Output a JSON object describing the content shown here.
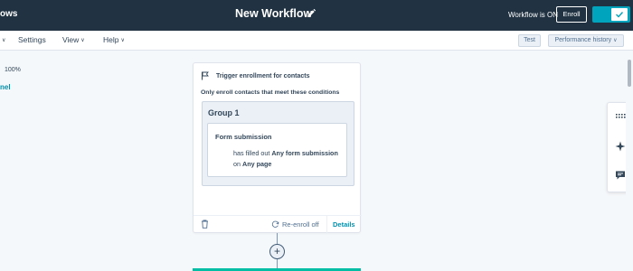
{
  "topbar": {
    "app_name": "ows",
    "title": "New Workflow",
    "workflow_status": "Workflow is ON",
    "enroll_label": "Enroll"
  },
  "menubar": {
    "items": [
      {
        "label": "Settings"
      },
      {
        "label": "View"
      },
      {
        "label": "Help"
      }
    ],
    "test_label": "Test",
    "performance_label": "Performance history"
  },
  "canvas": {
    "zoom": "100%",
    "left_link": "nel"
  },
  "trigger": {
    "title": "Trigger enrollment for contacts",
    "conditions_text": "Only enroll contacts that meet these conditions",
    "group_title": "Group 1",
    "filter": {
      "title": "Form submission",
      "prefix": "has filled out ",
      "any_form": "Any form submission",
      "on": " on ",
      "any_page": "Any page"
    },
    "reenroll": "Re-enroll off",
    "details": "Details"
  },
  "colors": {
    "topbar": "#213343",
    "accent": "#00a4bd",
    "link": "#0091ae",
    "next_action": "#00bda5"
  },
  "icons": {
    "edit": "pencil-icon",
    "flag": "flag-icon",
    "trash": "trash-icon",
    "reenroll": "refresh-icon",
    "add": "plus-icon",
    "toggle_check": "check-icon",
    "side_grid": "keypad-icon",
    "side_sparkle": "sparkle-icon",
    "side_chat": "chat-icon"
  }
}
